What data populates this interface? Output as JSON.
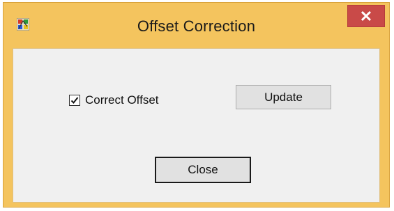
{
  "window": {
    "title": "Offset Correction",
    "app_icon": "app-icon",
    "close_glyph": "✕"
  },
  "form": {
    "correct_offset": {
      "label": "Correct Offset",
      "checked": true
    },
    "update_label": "Update",
    "close_label": "Close"
  },
  "colors": {
    "title_bar": "#f4c45e",
    "close_button": "#c94a48",
    "client_area": "#f0f0f0"
  }
}
